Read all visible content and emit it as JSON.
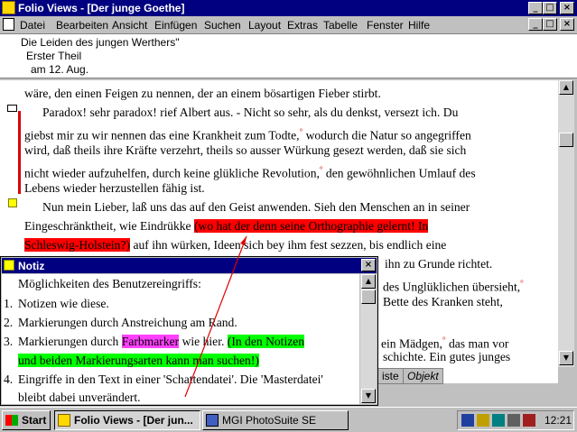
{
  "window": {
    "title": "Folio Views - [Der junge Goethe]",
    "min": "_",
    "max": "□",
    "close": "×",
    "doc_min": "_",
    "doc_max": "□",
    "doc_close": "×"
  },
  "menu": {
    "items": [
      "Datei",
      "Bearbeiten",
      "Ansicht",
      "Einfügen",
      "Suchen",
      "Layout",
      "Extras",
      "Tabelle",
      "Fenster",
      "Hilfe"
    ]
  },
  "header": {
    "lines": [
      "Die Leiden des jungen Werthers\"",
      "Erster Theil",
      "am 12. Aug."
    ]
  },
  "main": {
    "line0": "wäre, den einen Feigen zu nennen, der an einem bösartigen Fieber stirbt.",
    "line1": "Paradox! sehr paradox! rief Albert aus. - Nicht so sehr, als du denkst, versezt ich. Du",
    "line2a": "giebst mir zu wir nennen das eine Krankheit zum Todte,",
    "line2b": " wodurch die Natur so angegriffen",
    "line3": "wird, daß theils ihre Kräfte verzehrt, theils so ausser Würkung gesezt werden, daß sie sich",
    "line4a": "nicht wieder aufzuhelfen, durch keine glükliche Revolution,",
    "line4b": " den gewöhnlichen Umlauf des",
    "line5": "Lebens wieder herzustellen fähig ist.",
    "line6": "Nun mein Lieber, laß uns das auf den Geist anwenden. Sieh den Menschen an in seiner",
    "line7a": "Eingeschränktheit, wie Eindrükke ",
    "line7b": "(wo hat der denn seine Orthographie gelernt! In",
    "line8a": "Schleswig-Holstein?)",
    "line8b": " auf ihn würken, Ideen sich bey ihm fest sezzen, bis endlich eine",
    "line9": "ihn zu Grunde richtet.",
    "line10": "des Unglüklichen übersieht,",
    "line11": "Bette des Kranken steht,",
    "line12a": "ein Mädgen,",
    "line12b": " das man vor",
    "line13": "schichte. Ein gutes junges",
    "ref": "°"
  },
  "tabs": {
    "tab1": "iste",
    "tab2": "Objekt"
  },
  "note": {
    "title": "Notiz",
    "close": "×",
    "line0": "Möglichkeiten des Benutzereingriffs:",
    "n1": "1.",
    "item1": "Notizen wie diese.",
    "n2": "2.",
    "item2": "Markierungen durch Anstreichung am Rand.",
    "n3": "3.",
    "item3a": "Markierungen durch ",
    "item3b": "Farbmarker",
    "item3c": " wie hier. ",
    "item3d": "(In den Notizen",
    "item3e": "und beiden Markierungsarten kann man suchen!)",
    "n4": "4.",
    "item4a": "Eingriffe in den Text in einer 'Schattendatei'. Die 'Masterdatei'",
    "item4b": "bleibt dabei unverändert."
  },
  "taskbar": {
    "start": "Start",
    "task1": "Folio Views - [Der jun...",
    "task2": "MGI PhotoSuite SE",
    "clock": "12:21"
  }
}
